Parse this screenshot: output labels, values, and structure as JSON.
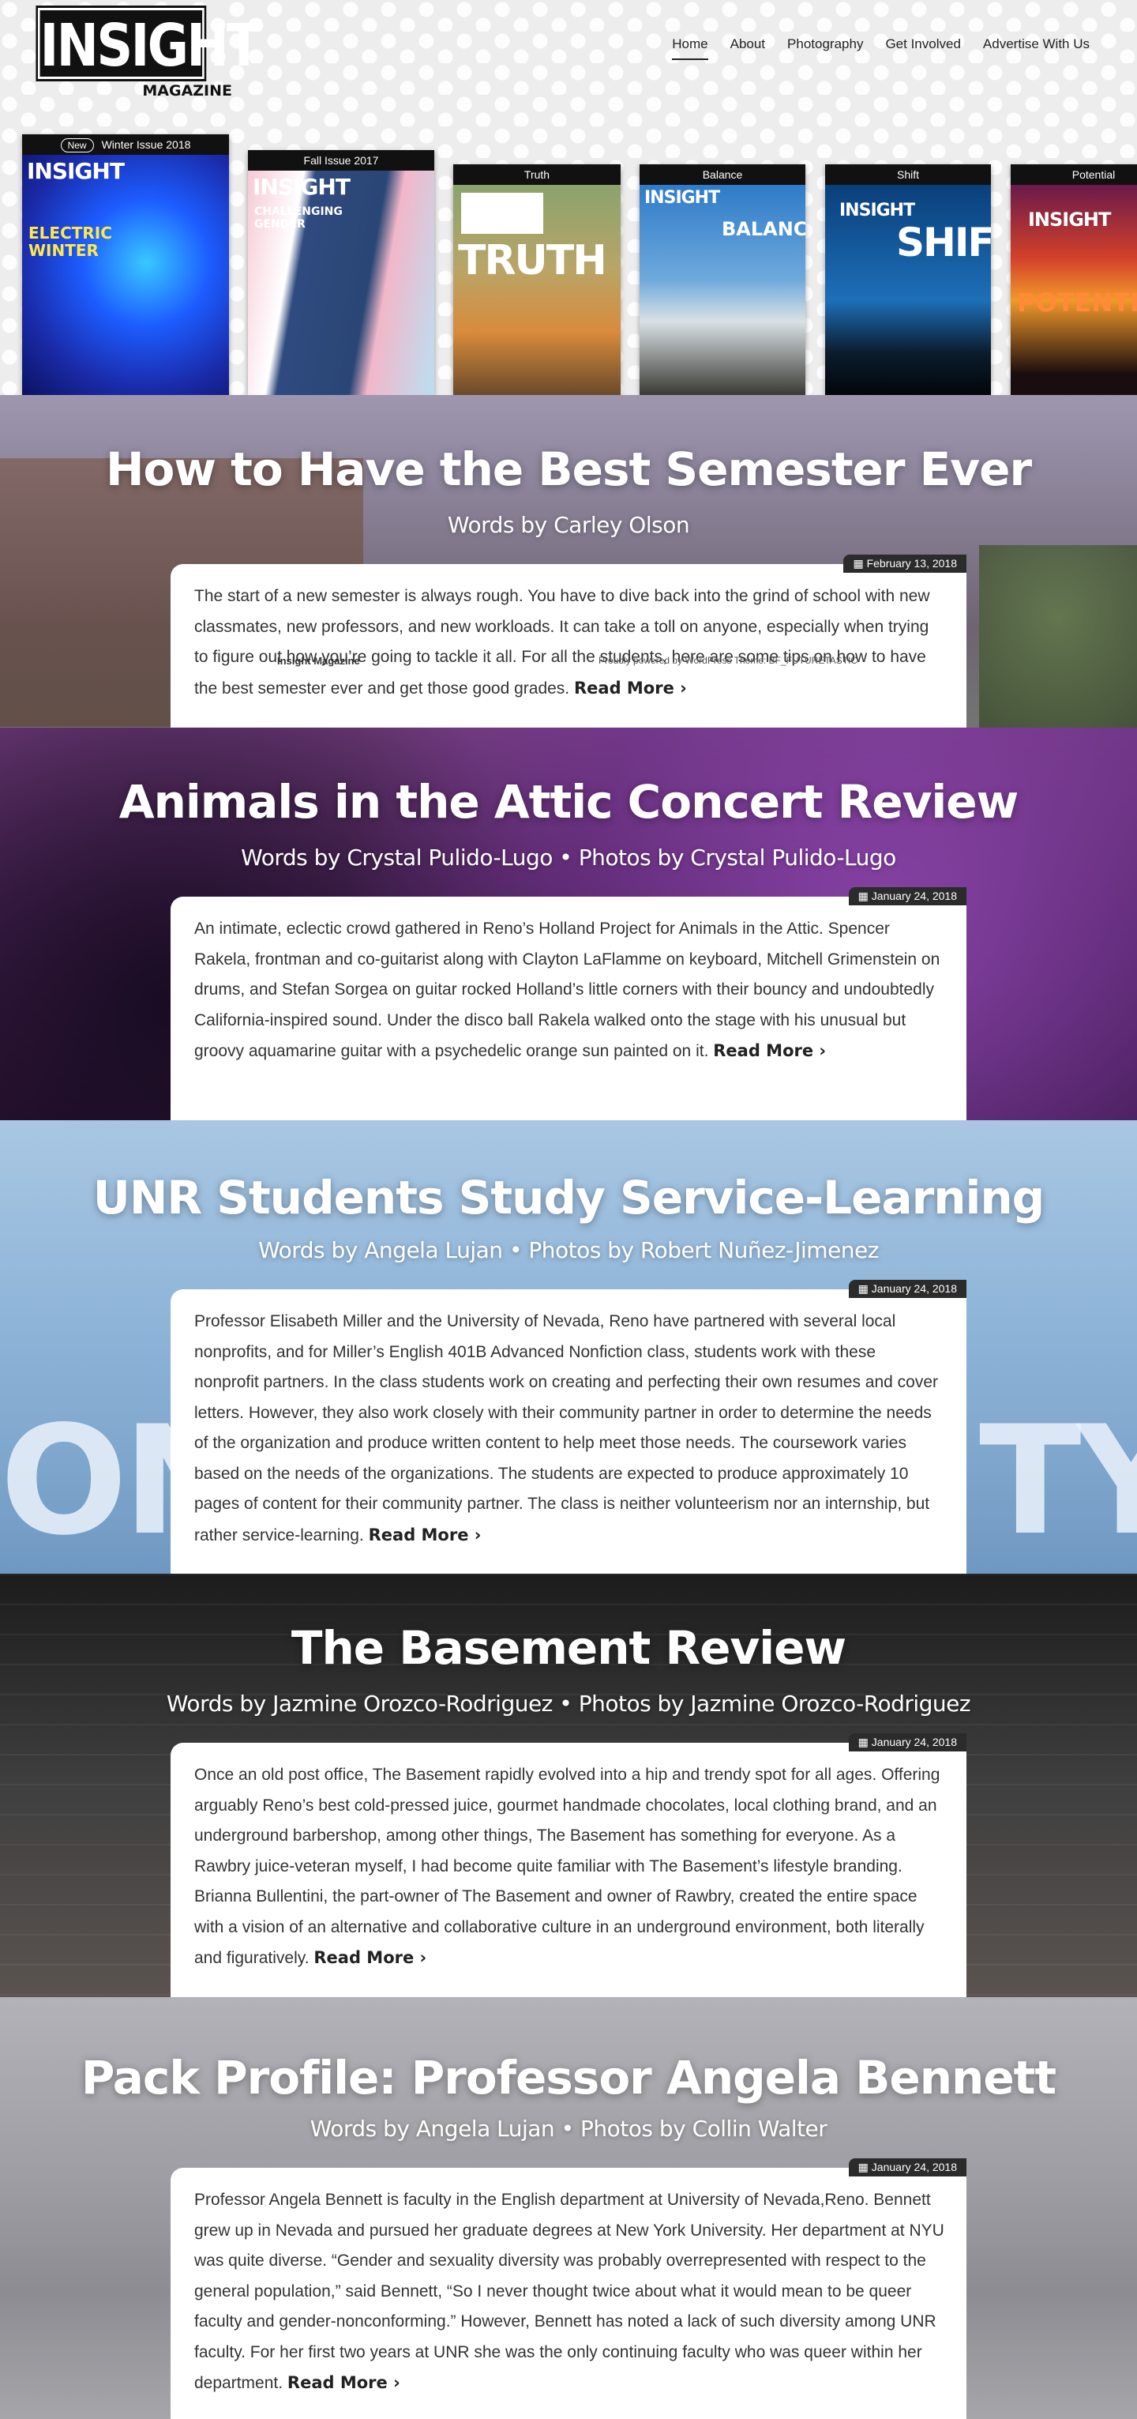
{
  "site": {
    "logo_main": "INSIGHT",
    "logo_sub": "MAGAZINE"
  },
  "nav": {
    "items": [
      {
        "label": "Home",
        "active": true
      },
      {
        "label": "About"
      },
      {
        "label": "Photography"
      },
      {
        "label": "Get Involved"
      },
      {
        "label": "Advertise With Us"
      }
    ]
  },
  "issues": [
    {
      "badge": "New",
      "title": "Winter Issue 2018",
      "cover_logo": "INSIGHT",
      "cover_big": "ELECTRIC WINTER",
      "color": "#1a38c8"
    },
    {
      "title": "Fall Issue 2017",
      "cover_logo": "INSIGHT",
      "cover_big": "CHALLENGING GENDER",
      "color": "#e86d9e"
    },
    {
      "title": "Truth",
      "cover_big": "TRUTH",
      "color": "#d28b3c"
    },
    {
      "title": "Balance",
      "cover_logo": "INSIGHT",
      "cover_big": "BALANCE",
      "color": "#4a89c9"
    },
    {
      "title": "Shift",
      "cover_logo": "INSIGHT",
      "cover_big": "SHIFT",
      "color": "#0d3a73"
    },
    {
      "title": "Potential",
      "cover_logo": "INSIGHT",
      "cover_big": "POTENTIA",
      "color": "#d84a22"
    }
  ],
  "posts": [
    {
      "title": "How to Have the Best Semester Ever",
      "byline": "Words by Carley Olson",
      "date": "February 13, 2018",
      "excerpt": "The start of a new semester is always rough. You have to dive back into the grind of school with new classmates, new professors, and new workloads. It can take a toll on anyone, especially when trying to figure out how you’re going to tackle it all. For all the students, here are some tips on how to have the best semester ever and get those good grades.",
      "read_more": "Read More ›",
      "bg": "#7a7f93"
    },
    {
      "title": "Animals in the Attic Concert Review",
      "byline": "Words by Crystal Pulido-Lugo • Photos by Crystal Pulido-Lugo",
      "date": "January 24, 2018",
      "excerpt": "An intimate, eclectic crowd gathered in Reno’s Holland Project for Animals in the Attic. Spencer Rakela, frontman and co-guitarist along with Clayton LaFlamme on keyboard, Mitchell Grimenstein on drums, and Stefan Sorgea on guitar rocked Holland’s little corners with their bouncy and undoubtedly California-inspired sound. Under the disco ball Rakela walked onto the stage with his unusual but groovy aquamarine guitar with a psychedelic orange sun painted on it.",
      "read_more": "Read More ›",
      "bg": "#5a2a6a"
    },
    {
      "title": "UNR Students Study Service-Learning",
      "byline": "Words by Angela Lujan • Photos by Robert Nuñez-Jimenez",
      "date": "January 24, 2018",
      "excerpt": "Professor Elisabeth Miller and the University of Nevada, Reno have partnered with several local nonprofits, and for Miller’s English 401B Advanced Nonfiction class, students work with these nonprofit partners. In the class students work on creating and perfecting their own resumes and cover letters. However, they also work closely with their community partner in order to determine the needs of the organization and produce written content to help meet those needs. The coursework varies based on the needs of the organizations. The students are expected to produce approximately 10 pages of content for their community partner. The class is neither volunteerism nor an internship, but rather service-learning.",
      "read_more": "Read More ›",
      "bg": "#8fb3d4",
      "bg_text_left": "ON",
      "bg_text_right": "TY"
    },
    {
      "title": "The Basement Review",
      "byline": "Words by Jazmine Orozco-Rodriguez • Photos by Jazmine Orozco-Rodriguez",
      "date": "January 24, 2018",
      "excerpt": "Once an old post office, The Basement rapidly evolved into a hip and trendy spot for all ages. Offering arguably Reno’s best cold-pressed juice, gourmet handmade chocolates, local clothing brand, and an underground barbershop, among other things, The Basement has something for everyone. As a Rawbry juice-veteran myself, I had become quite familiar with The Basement’s lifestyle branding. Brianna Bullentini, the part-owner of The Basement and owner of Rawbry, created the entire space with a vision of an alternative and collaborative culture in an underground environment, both literally and figuratively.",
      "read_more": "Read More ›",
      "bg": "#3a3a3a"
    },
    {
      "title": "Pack Profile: Professor Angela Bennett",
      "byline": "Words by Angela Lujan • Photos by Collin Walter",
      "date": "January 24, 2018",
      "excerpt": "Professor Angela Bennett is faculty in the English department at University of Nevada,Reno. Bennett grew up in Nevada and pursued her graduate degrees at New York University. Her department at NYU was quite diverse. “Gender and sexuality diversity was probably overrepresented with respect to the general population,” said Bennett, “So I never thought twice about what it would mean to be queer faculty and gender-nonconforming.” However, Bennett has noted a lack of such diversity among UNR faculty. For her first two years at UNR she was the only continuing faculty who was queer within her department.",
      "read_more": "Read More ›",
      "bg": "#a8a7ad"
    }
  ],
  "footer": {
    "site_name": "Insight Magazine",
    "credit": "Proudly powered by WordPress Theme: BF_FUTURETASTIC"
  }
}
